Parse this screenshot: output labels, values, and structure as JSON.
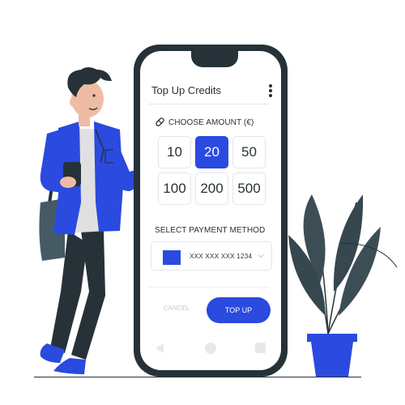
{
  "app": {
    "title": "Top Up Credits"
  },
  "amount_section": {
    "label": "CHOOSE AMOUNT (€)",
    "icon": "coupon-icon",
    "options": [
      "10",
      "20",
      "50",
      "100",
      "200",
      "500"
    ],
    "selected": "20"
  },
  "payment_section": {
    "label": "SELECT PAYMENT METHOD",
    "card_number": "XXX XXX XXX 1234",
    "card_color": "#2a4ae0"
  },
  "actions": {
    "cancel": "CANCEL",
    "top_up": "TOP UP"
  },
  "nav": {
    "back": "back-icon",
    "home": "home-icon",
    "recent": "recent-apps-icon"
  },
  "colors": {
    "accent": "#2a4ae0",
    "dark": "#263238"
  }
}
